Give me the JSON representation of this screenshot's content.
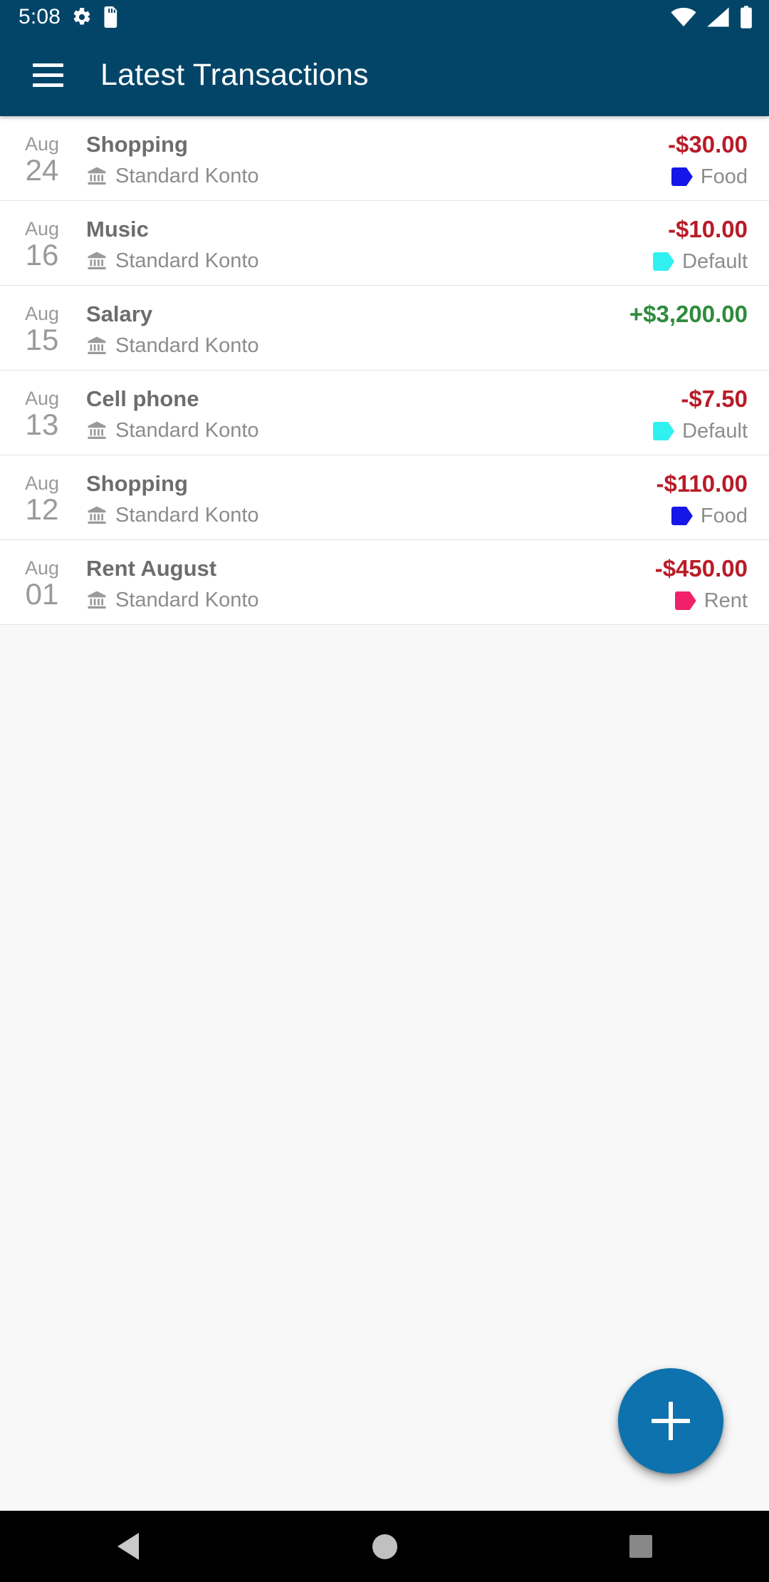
{
  "status_bar": {
    "time": "5:08",
    "icons": [
      "gear-icon",
      "sd-card-icon"
    ],
    "right_icons": [
      "wifi-icon",
      "cellular-signal-icon",
      "battery-icon"
    ],
    "background_color": "#034568"
  },
  "app_bar": {
    "menu_label": "menu",
    "title": "Latest Transactions",
    "background_color": "#034568"
  },
  "colors": {
    "primary": "#034568",
    "negative_amount": "#b81c28",
    "positive_amount": "#2e8b3d",
    "fab": "#0d72ad",
    "tag_food": "#1616e8",
    "tag_default": "#30f0f0",
    "tag_rent": "#f0216a"
  },
  "transactions": [
    {
      "month": "Aug",
      "day": "24",
      "title": "Shopping",
      "account": "Standard Konto",
      "amount": "-$30.00",
      "amount_sign": "neg",
      "tag": "Food",
      "tag_color": "#1616e8"
    },
    {
      "month": "Aug",
      "day": "16",
      "title": "Music",
      "account": "Standard Konto",
      "amount": "-$10.00",
      "amount_sign": "neg",
      "tag": "Default",
      "tag_color": "#30f0f0"
    },
    {
      "month": "Aug",
      "day": "15",
      "title": "Salary",
      "account": "Standard Konto",
      "amount": "+$3,200.00",
      "amount_sign": "pos",
      "tag": "",
      "tag_color": ""
    },
    {
      "month": "Aug",
      "day": "13",
      "title": "Cell phone",
      "account": "Standard Konto",
      "amount": "-$7.50",
      "amount_sign": "neg",
      "tag": "Default",
      "tag_color": "#30f0f0"
    },
    {
      "month": "Aug",
      "day": "12",
      "title": "Shopping",
      "account": "Standard Konto",
      "amount": "-$110.00",
      "amount_sign": "neg",
      "tag": "Food",
      "tag_color": "#1616e8"
    },
    {
      "month": "Aug",
      "day": "01",
      "title": "Rent August",
      "account": "Standard Konto",
      "amount": "-$450.00",
      "amount_sign": "neg",
      "tag": "Rent",
      "tag_color": "#f0216a"
    }
  ],
  "fab": {
    "icon": "plus-icon",
    "label": "Add transaction"
  },
  "nav_bar": {
    "back": "back-icon",
    "home": "home-icon",
    "recents": "recents-icon"
  }
}
